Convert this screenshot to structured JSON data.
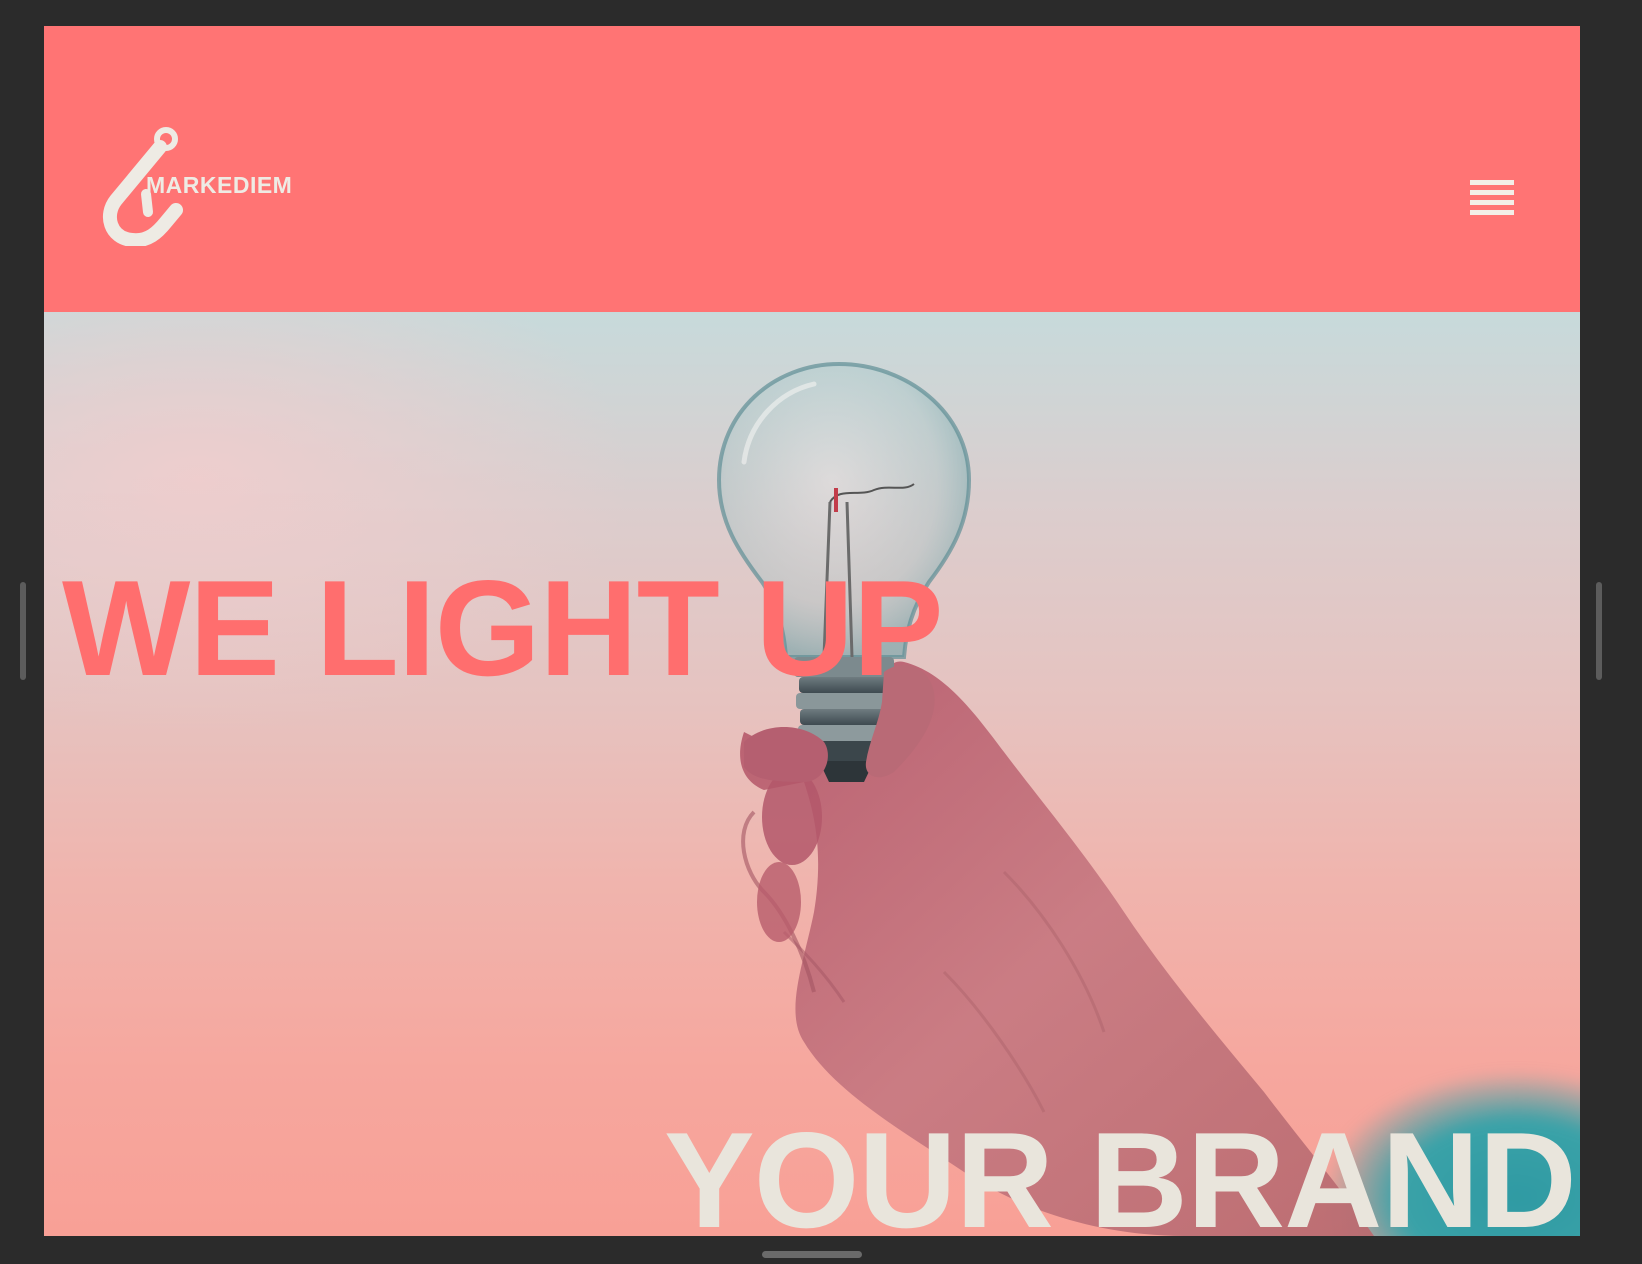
{
  "header": {
    "logo_text": "MARKEDIEM",
    "menu_icon": "hamburger-menu-icon",
    "background_color": "#ff7474"
  },
  "hero": {
    "headline_top": "WE LIGHT UP",
    "headline_bottom": "YOUR BRAND",
    "headline_top_color": "#ff6e6e",
    "headline_bottom_color": "#e9e5dc",
    "image": "hand-holding-lightbulb"
  }
}
